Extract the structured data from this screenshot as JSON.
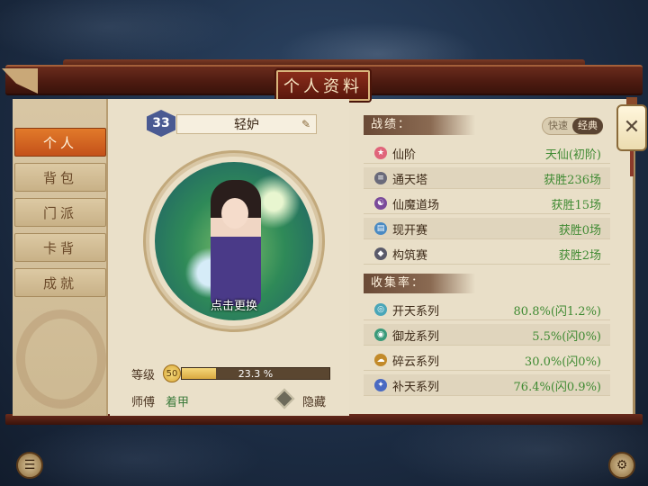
{
  "window": {
    "title": "个人资料"
  },
  "sidebar": {
    "items": [
      {
        "label": "个人",
        "active": true
      },
      {
        "label": "背包",
        "active": false
      },
      {
        "label": "门派",
        "active": false
      },
      {
        "label": "卡背",
        "active": false
      },
      {
        "label": "成就",
        "active": false
      }
    ]
  },
  "profile": {
    "level_badge": "33",
    "name": "轻妒",
    "change_avatar_label": "点击更换",
    "level_label": "等级",
    "level_value": "50",
    "xp_percent_text": "23.3 %",
    "xp_fraction": 0.233,
    "master_label": "师傅",
    "master_value": "着甲",
    "hide_label": "隐藏"
  },
  "record": {
    "header": "战绩：",
    "mode_options": [
      "快速",
      "经典"
    ],
    "mode_selected": "经典",
    "rows": [
      {
        "label": "仙阶",
        "value": "天仙(初阶)",
        "icon": "star-icon",
        "icon_color": "#e0647a"
      },
      {
        "label": "通天塔",
        "value": "获胜236场",
        "icon": "tower-icon",
        "icon_color": "#6a6a7a"
      },
      {
        "label": "仙魔道场",
        "value": "获胜15场",
        "icon": "yinyang-icon",
        "icon_color": "#7a4a9a"
      },
      {
        "label": "现开赛",
        "value": "获胜0场",
        "icon": "cards-icon",
        "icon_color": "#4a8ac2"
      },
      {
        "label": "构筑赛",
        "value": "获胜2场",
        "icon": "build-icon",
        "icon_color": "#5a5a6a"
      }
    ]
  },
  "collection": {
    "header": "收集率：",
    "rows": [
      {
        "label": "开天系列",
        "value": "80.8%(闪1.2%)",
        "icon": "swirl-icon",
        "icon_color": "#4aa6b8"
      },
      {
        "label": "御龙系列",
        "value": "5.5%(闪0%)",
        "icon": "dragon-icon",
        "icon_color": "#3a9a7a"
      },
      {
        "label": "碎云系列",
        "value": "30.0%(闪0%)",
        "icon": "cloud-icon",
        "icon_color": "#c28a2a"
      },
      {
        "label": "补天系列",
        "value": "76.4%(闪0.9%)",
        "icon": "sky-icon",
        "icon_color": "#4a6ac2"
      }
    ]
  },
  "controls": {
    "close_symbol": "✕"
  }
}
